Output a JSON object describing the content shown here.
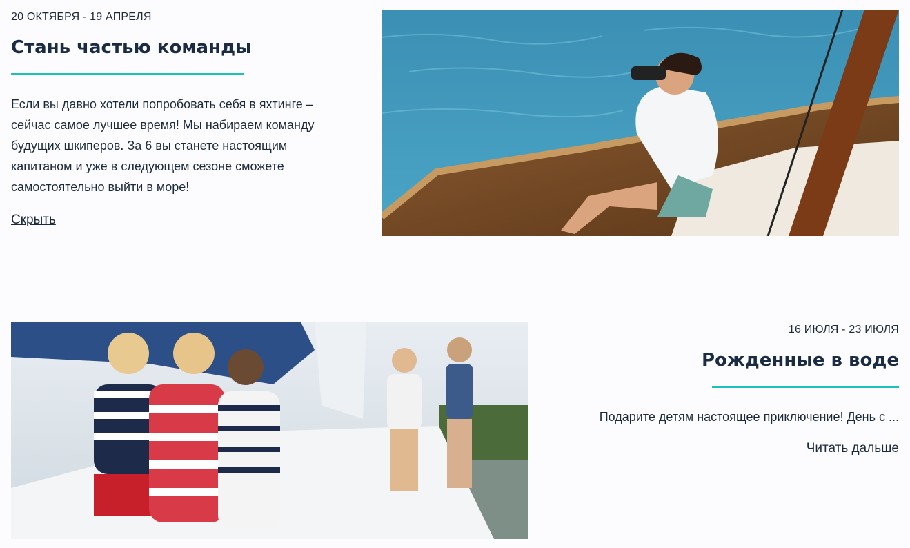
{
  "events": [
    {
      "date": "20 ОКТЯБРЯ - 19 АПРЕЛЯ",
      "title": "Стань частью команды",
      "text_lines": [
        "Если вы давно хотели попробовать себя в яхтинге –",
        "сейчас самое лучшее время! Мы набираем команду",
        "будущих шкиперов. За 6 вы станете настоящим",
        "капитаном и уже в следующем сезоне сможете",
        "самостоятельно выйти в море!"
      ],
      "link": "Скрыть",
      "image": "yacht-binoculars-photo"
    },
    {
      "date": "16 ИЮЛЯ - 23 ИЮЛЯ",
      "title": "Рожденные в воде",
      "text": "Подарите детям настоящее приключение! День с ...",
      "link": "Читать дальше",
      "image": "kids-on-yacht-photo"
    }
  ],
  "colors": {
    "accent": "#1fbfba",
    "heading": "#1a2b44",
    "background": "#fcfbfe"
  }
}
